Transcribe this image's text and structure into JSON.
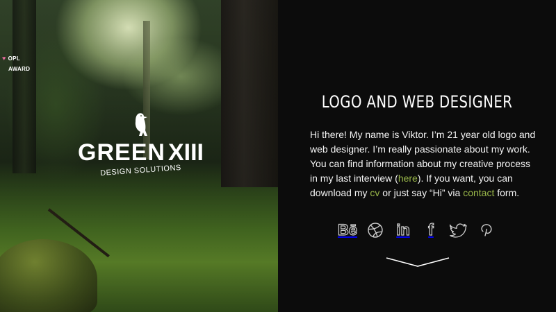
{
  "badge": {
    "line1": "OPL",
    "line2": "AWARD",
    "heart_color": "#e26a9b"
  },
  "logo": {
    "wordmark": "GREEN",
    "numeral": "XIII",
    "tagline": "DESIGN SOLUTIONS",
    "icon": "raven-icon"
  },
  "about": {
    "heading": "LOGO AND WEB DESIGNER",
    "text_1": "Hi there! My name is Viktor. I’m 21 year old logo and web designer. I’m really passionate about my work. You can find information about my creative process in my last interview (",
    "link_here": "here",
    "text_2": "). If you want, you can download my ",
    "link_cv": "cv",
    "text_3": " or just say “Hi” via ",
    "link_contact": "contact",
    "text_4": " form.",
    "link_color": "#9ab84a"
  },
  "socials": [
    {
      "name": "behance-icon",
      "glyph": "Bē"
    },
    {
      "name": "dribbble-icon"
    },
    {
      "name": "linkedin-icon",
      "glyph": "in"
    },
    {
      "name": "facebook-icon",
      "glyph": "f"
    },
    {
      "name": "twitter-icon"
    },
    {
      "name": "pinterest-icon"
    }
  ],
  "scroll_indicator": "chevron-down-icon",
  "colors": {
    "panel_bg": "#0c0c0c",
    "text": "#ffffff",
    "icon_stroke": "#cfcfcf"
  }
}
